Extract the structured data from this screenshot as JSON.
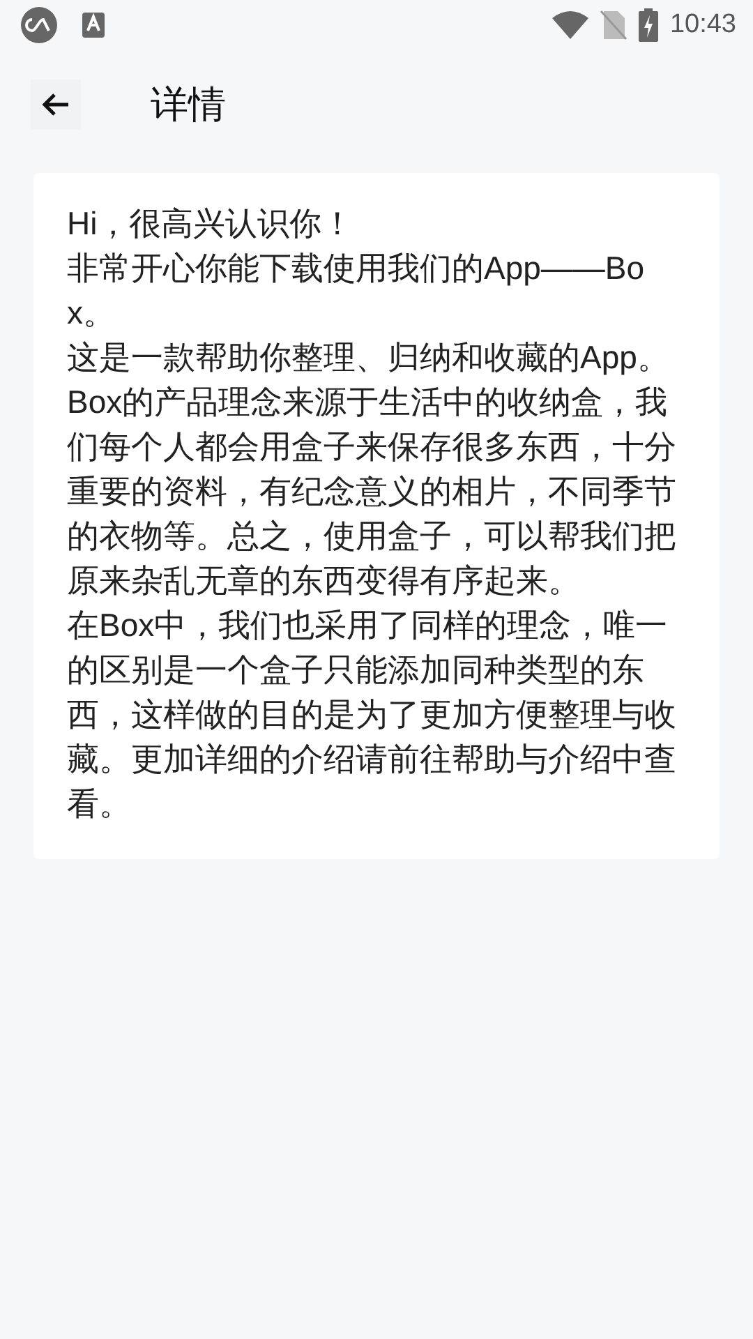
{
  "status_bar": {
    "time": "10:43"
  },
  "header": {
    "title": "详情"
  },
  "paragraphs": [
    "Hi，很高兴认识你！",
    "非常开心你能下载使用我们的App——Box。",
    "这是一款帮助你整理、归纳和收藏的App。",
    "Box的产品理念来源于生活中的收纳盒，我们每个人都会用盒子来保存很多东西，十分重要的资料，有纪念意义的相片，不同季节的衣物等。总之，使用盒子，可以帮我们把原来杂乱无章的东西变得有序起来。",
    "在Box中，我们也采用了同样的理念，唯一的区别是一个盒子只能添加同种类型的东西，这样做的目的是为了更加方便整理与收藏。更加详细的介绍请前往帮助与介绍中查看。"
  ]
}
